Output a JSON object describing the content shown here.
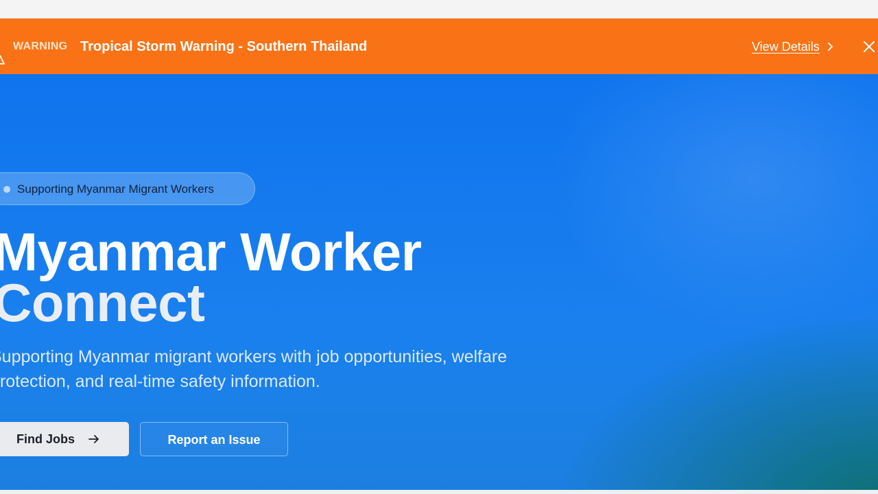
{
  "alert": {
    "level": "WARNING",
    "title": "Tropical Storm Warning - Southern Thailand",
    "link_label": "View Details",
    "color": "#f97316"
  },
  "hero": {
    "badge": "Supporting Myanmar Migrant Workers",
    "title_line1": "Myanmar Worker",
    "title_line2": "Connect",
    "description": "Supporting Myanmar migrant workers with job opportunities, welfare protection, and real-time safety information.",
    "primary_button": "Find Jobs",
    "secondary_button": "Report an Issue",
    "accent": "#1a80ee"
  },
  "icons": {
    "alert": "warning-triangle-icon",
    "link": "chevron-right-icon",
    "close": "close-icon",
    "primary": "arrow-right-icon"
  }
}
